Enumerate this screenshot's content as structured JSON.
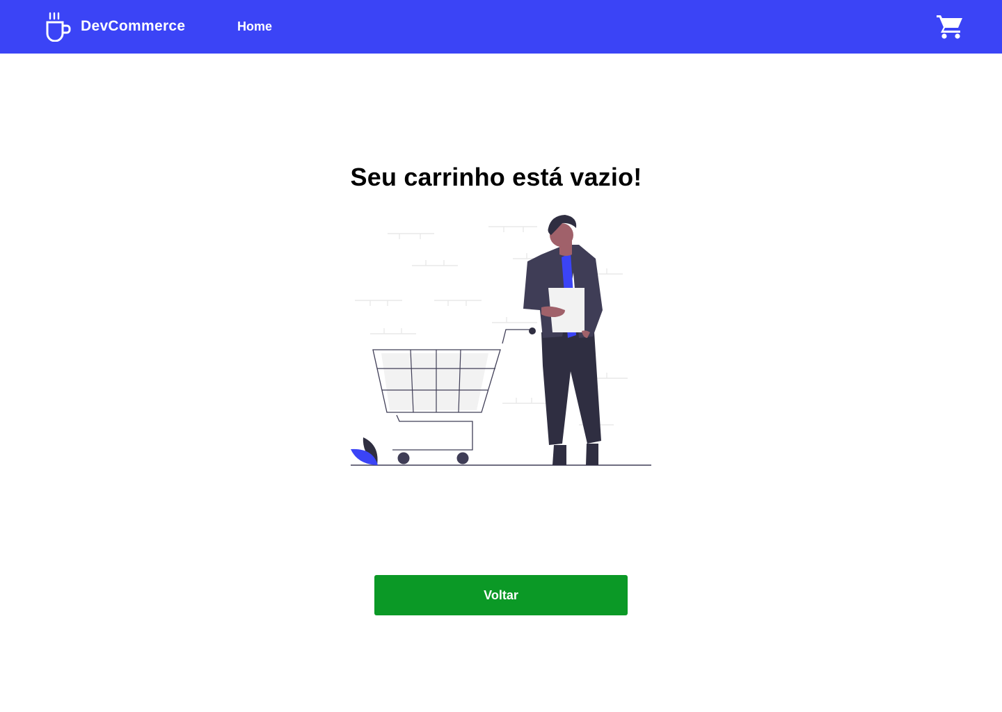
{
  "header": {
    "brand_name": "DevCommerce",
    "brand_icon": "coffee-cup-icon",
    "nav_home_label": "Home",
    "cart_icon": "shopping-cart-icon",
    "background_color": "#3b44f6"
  },
  "main": {
    "empty_cart_title": "Seu carrinho está vazio!",
    "illustration": "empty-cart-illustration",
    "back_button_label": "Voltar",
    "back_button_color": "#0b9926"
  }
}
